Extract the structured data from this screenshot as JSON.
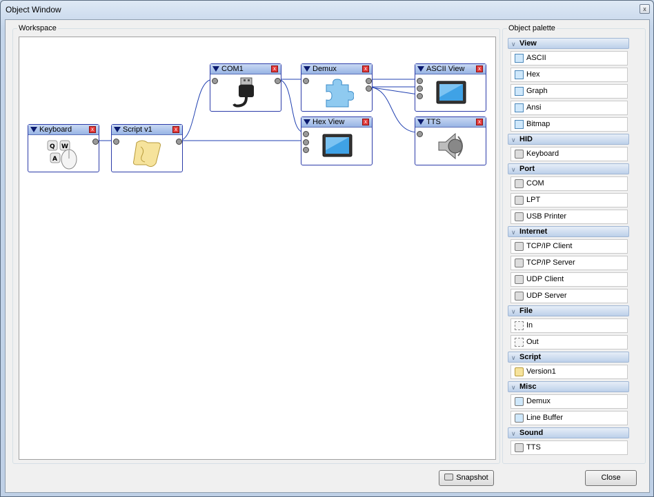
{
  "window": {
    "title": "Object Window",
    "close_glyph": "x"
  },
  "workspace": {
    "label": "Workspace",
    "nodes": [
      {
        "id": "keyboard",
        "title": "Keyboard",
        "icon": "keyboard-mouse-icon"
      },
      {
        "id": "script",
        "title": "Script v1",
        "icon": "scroll-icon"
      },
      {
        "id": "com",
        "title": "COM1",
        "icon": "usb-plug-icon"
      },
      {
        "id": "demux",
        "title": "Demux",
        "icon": "puzzle-icon"
      },
      {
        "id": "hexview",
        "title": "Hex View",
        "icon": "monitor-icon"
      },
      {
        "id": "asciiview",
        "title": "ASCII View",
        "icon": "monitor-icon"
      },
      {
        "id": "tts",
        "title": "TTS",
        "icon": "speaker-icon"
      }
    ]
  },
  "palette": {
    "label": "Object palette",
    "categories": [
      {
        "name": "View",
        "items": [
          "ASCII",
          "Hex",
          "Graph",
          "Ansi",
          "Bitmap"
        ],
        "icon": "view-icon"
      },
      {
        "name": "HID",
        "items": [
          "Keyboard"
        ],
        "icon": "keyboard-icon"
      },
      {
        "name": "Port",
        "items": [
          "COM",
          "LPT",
          "USB Printer"
        ],
        "icon": "plug-icon"
      },
      {
        "name": "Internet",
        "items": [
          "TCP/IP Client",
          "TCP/IP Server",
          "UDP Client",
          "UDP Server"
        ],
        "icon": "network-icon"
      },
      {
        "name": "File",
        "items": [
          "In",
          "Out"
        ],
        "icon": "file-icon"
      },
      {
        "name": "Script",
        "items": [
          "Version1"
        ],
        "icon": "scroll-icon"
      },
      {
        "name": "Misc",
        "items": [
          "Demux",
          "Line Buffer"
        ],
        "icon": "puzzle-icon"
      },
      {
        "name": "Sound",
        "items": [
          "TTS"
        ],
        "icon": "speaker-icon"
      }
    ]
  },
  "buttons": {
    "snapshot": "Snapshot",
    "close": "Close"
  },
  "colors": {
    "wire": "#1f3fb0",
    "node_border": "#2a3aa8",
    "header": "#a9c1ea"
  }
}
